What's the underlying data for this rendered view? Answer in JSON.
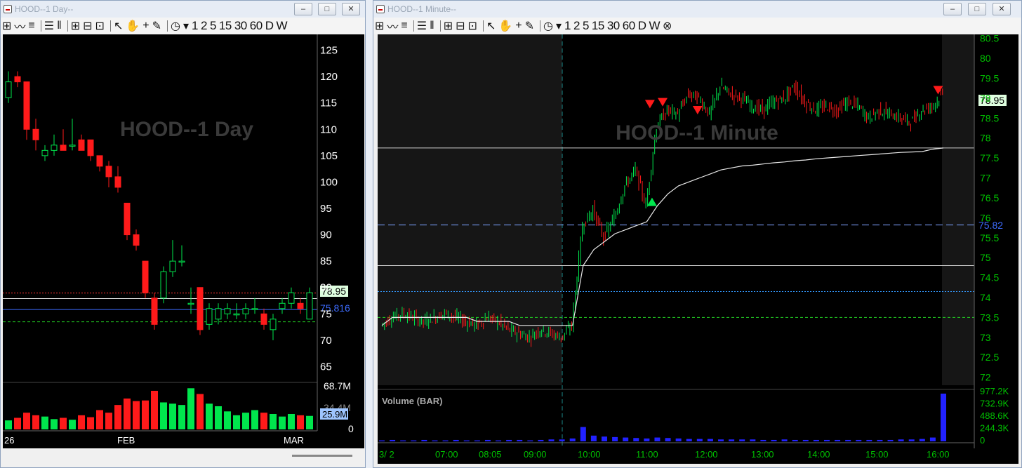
{
  "left_window": {
    "title": "HOOD--1 Day--",
    "watermark": "HOOD--1 Day",
    "toolbar": [
      "1",
      "2",
      "5",
      "15",
      "30",
      "60",
      "D",
      "W"
    ],
    "price_axis": [
      "125",
      "120",
      "115",
      "110",
      "105",
      "100",
      "95",
      "90",
      "85",
      "80",
      "75",
      "70",
      "65"
    ],
    "last_price_label": "78.95",
    "vwap_label": "75.816",
    "volume_axis": [
      "68.7M",
      "34.4M",
      "0"
    ],
    "volume_last_label": "25.9M",
    "time_axis": [
      "26",
      "FEB",
      "MAR"
    ]
  },
  "right_window": {
    "title": "HOOD--1 Minute--",
    "watermark": "HOOD--1 Minute",
    "toolbar": [
      "1",
      "2",
      "5",
      "15",
      "30",
      "60",
      "D",
      "W"
    ],
    "price_axis": [
      "80.5",
      "80",
      "79.5",
      "79",
      "78.5",
      "78",
      "77.5",
      "77",
      "76.5",
      "76",
      "75.5",
      "75",
      "74.5",
      "74",
      "73.5",
      "73",
      "72.5",
      "72"
    ],
    "last_price_label": "78.95",
    "vwap_label": "75.82",
    "volume_title": "Volume (BAR)",
    "volume_axis": [
      "977.2K",
      "732.9K",
      "488.6K",
      "244.3K",
      "0"
    ],
    "time_axis": [
      "3/ 2",
      "07:00",
      "08:05",
      "09:00",
      "10:00",
      "11:00",
      "12:00",
      "13:00",
      "14:00",
      "15:00",
      "16:00"
    ]
  },
  "colors": {
    "up": "#00e64d",
    "down": "#ff1a1a",
    "axis_text": "#00c000",
    "vwap_blue": "#3d6cff",
    "background": "#000000"
  },
  "chart_data": [
    {
      "type": "candlestick",
      "title": "HOOD--1 Day",
      "ylim": [
        62,
        128
      ],
      "candles": [
        {
          "o": 116,
          "h": 121,
          "l": 115,
          "c": 119
        },
        {
          "o": 120,
          "h": 121,
          "l": 118,
          "c": 119
        },
        {
          "o": 119,
          "h": 119,
          "l": 108,
          "c": 110
        },
        {
          "o": 110,
          "h": 112,
          "l": 106,
          "c": 108
        },
        {
          "o": 105,
          "h": 107,
          "l": 104,
          "c": 106
        },
        {
          "o": 106,
          "h": 109,
          "l": 105,
          "c": 107
        },
        {
          "o": 107,
          "h": 110,
          "l": 106,
          "c": 106
        },
        {
          "o": 107,
          "h": 112,
          "l": 106,
          "c": 107
        },
        {
          "o": 108,
          "h": 109,
          "l": 106,
          "c": 106
        },
        {
          "o": 108,
          "h": 108,
          "l": 104,
          "c": 105
        },
        {
          "o": 105,
          "h": 105,
          "l": 102,
          "c": 103
        },
        {
          "o": 103,
          "h": 104,
          "l": 99,
          "c": 101
        },
        {
          "o": 101,
          "h": 103,
          "l": 98,
          "c": 99
        },
        {
          "o": 96,
          "h": 96,
          "l": 89,
          "c": 90
        },
        {
          "o": 90,
          "h": 91,
          "l": 87,
          "c": 88
        },
        {
          "o": 85,
          "h": 85,
          "l": 78,
          "c": 79
        },
        {
          "o": 78,
          "h": 79,
          "l": 72,
          "c": 73
        },
        {
          "o": 78,
          "h": 84,
          "l": 77,
          "c": 83
        },
        {
          "o": 83,
          "h": 89,
          "l": 82,
          "c": 85
        },
        {
          "o": 85,
          "h": 88,
          "l": 84,
          "c": 85
        },
        {
          "o": 77,
          "h": 80,
          "l": 75,
          "c": 77
        },
        {
          "o": 80,
          "h": 80,
          "l": 71,
          "c": 72
        },
        {
          "o": 73,
          "h": 77,
          "l": 72,
          "c": 76
        },
        {
          "o": 74,
          "h": 77,
          "l": 73,
          "c": 76
        },
        {
          "o": 75,
          "h": 77,
          "l": 74,
          "c": 76
        },
        {
          "o": 75,
          "h": 77,
          "l": 74,
          "c": 75
        },
        {
          "o": 75,
          "h": 77,
          "l": 74,
          "c": 76
        },
        {
          "o": 76,
          "h": 78,
          "l": 75,
          "c": 76
        },
        {
          "o": 75,
          "h": 76,
          "l": 72,
          "c": 73
        },
        {
          "o": 72,
          "h": 75,
          "l": 70,
          "c": 74
        },
        {
          "o": 76,
          "h": 78,
          "l": 75,
          "c": 77
        },
        {
          "o": 77,
          "h": 80,
          "l": 76,
          "c": 79
        },
        {
          "o": 77,
          "h": 78,
          "l": 75,
          "c": 76
        },
        {
          "o": 74,
          "h": 80,
          "l": 74,
          "c": 79
        }
      ],
      "volume": [
        14,
        18,
        26,
        22,
        20,
        16,
        18,
        15,
        22,
        19,
        30,
        26,
        38,
        48,
        44,
        45,
        60,
        42,
        40,
        38,
        64,
        55,
        40,
        36,
        28,
        22,
        26,
        30,
        26,
        24,
        20,
        24,
        22,
        21
      ],
      "lines": {
        "last": 78.95,
        "white": 77.9,
        "vwap": 75.816,
        "green": 73.5
      }
    },
    {
      "type": "line",
      "title": "HOOD--1 Minute",
      "ylim": [
        71.8,
        80.6
      ],
      "x_ticks": [
        "07:00",
        "08:05",
        "09:00",
        "10:00",
        "11:00",
        "12:00",
        "13:00",
        "14:00",
        "15:00",
        "16:00"
      ],
      "series": [
        {
          "name": "price",
          "values": [
            73.3,
            73.5,
            73.6,
            73.5,
            73.4,
            73.5,
            73.6,
            73.5,
            73.4,
            73.3,
            73.5,
            73.4,
            73.2,
            73.1,
            73.0,
            73.2,
            73.1,
            73.0,
            73.3,
            75.8,
            76.2,
            75.5,
            76.0,
            76.8,
            77.2,
            76.3,
            78.3,
            78.7,
            78.6,
            79.1,
            79.0,
            78.6,
            79.3,
            79.1,
            79.0,
            78.8,
            78.7,
            78.9,
            79.0,
            79.3,
            78.9,
            78.7,
            78.8,
            78.7,
            78.9,
            78.8,
            78.5,
            78.7,
            78.6,
            78.5,
            78.4,
            78.7,
            78.8,
            79.1
          ]
        },
        {
          "name": "vwap",
          "values": [
            73.3,
            73.5,
            73.5,
            73.5,
            73.5,
            73.5,
            73.5,
            73.5,
            73.5,
            73.4,
            73.4,
            73.4,
            73.4,
            73.3,
            73.3,
            73.3,
            73.3,
            73.3,
            73.3,
            74.8,
            75.2,
            75.4,
            75.6,
            75.7,
            75.8,
            75.9,
            76.3,
            76.6,
            76.8,
            76.9,
            77.0,
            77.1,
            77.2,
            77.25,
            77.3,
            77.32,
            77.35,
            77.38,
            77.4,
            77.43,
            77.45,
            77.48,
            77.5,
            77.52,
            77.54,
            77.56,
            77.58,
            77.6,
            77.62,
            77.64,
            77.65,
            77.66,
            77.72,
            77.75
          ]
        }
      ],
      "lines": {
        "white_top": 77.75,
        "vwap": 75.82,
        "white_bottom": 74.8,
        "blue_dotted": 74.15,
        "green": 73.5
      },
      "volume": [
        2,
        3,
        2,
        2,
        3,
        2,
        2,
        3,
        2,
        2,
        3,
        2,
        3,
        3,
        2,
        3,
        4,
        4,
        6,
        30,
        12,
        10,
        9,
        8,
        7,
        6,
        8,
        7,
        6,
        5,
        5,
        5,
        4,
        4,
        4,
        4,
        3,
        3,
        4,
        3,
        3,
        3,
        3,
        3,
        3,
        3,
        3,
        3,
        3,
        4,
        4,
        5,
        8,
        100
      ]
    }
  ]
}
